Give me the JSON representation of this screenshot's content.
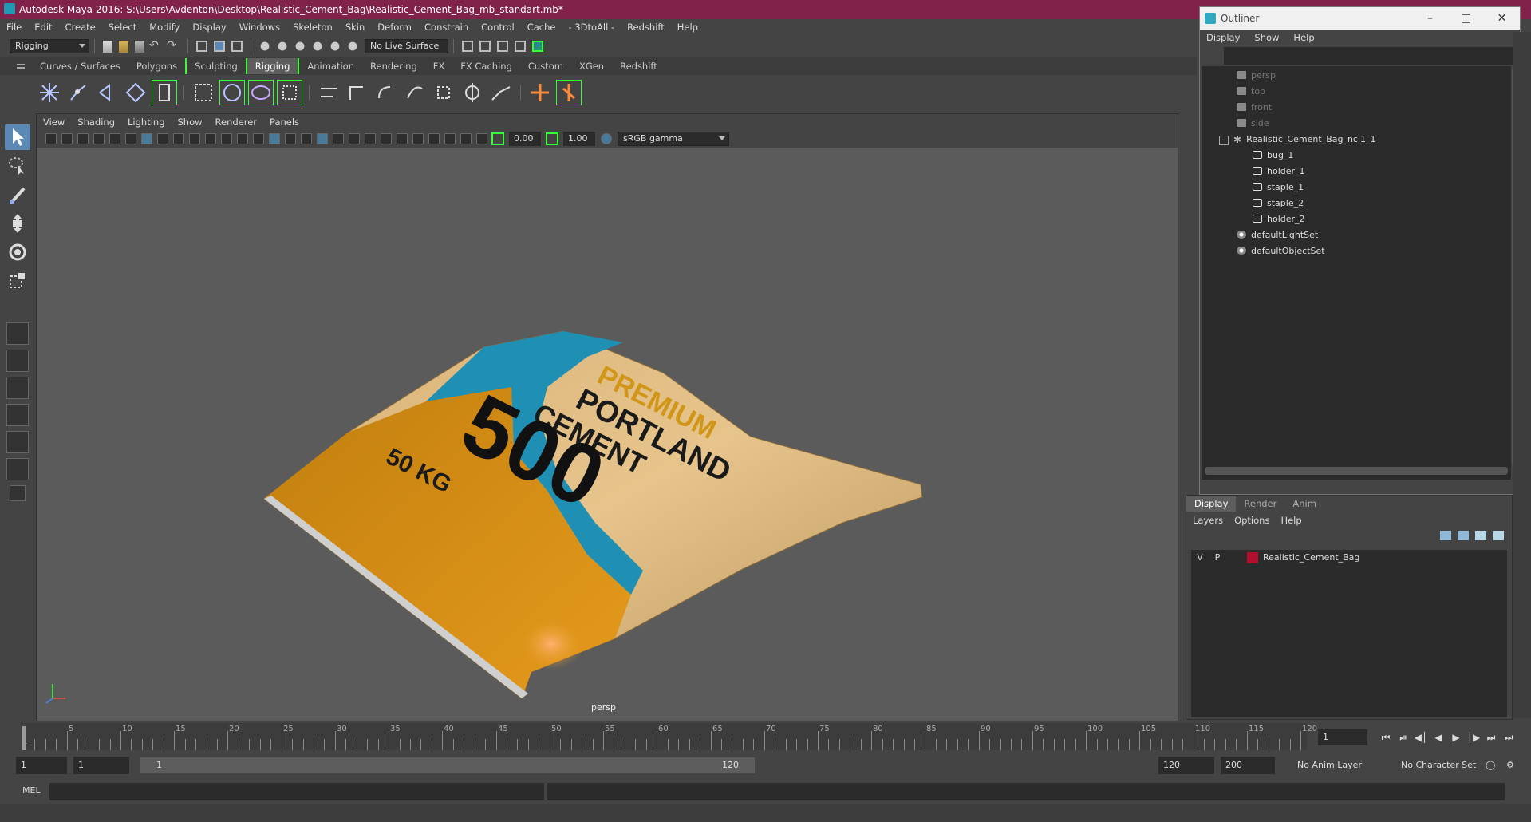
{
  "window": {
    "title": "Autodesk Maya 2016: S:\\Users\\Avdenton\\Desktop\\Realistic_Cement_Bag\\Realistic_Cement_Bag_mb_standart.mb*"
  },
  "menubar": [
    "File",
    "Edit",
    "Create",
    "Select",
    "Modify",
    "Display",
    "Windows",
    "Skeleton",
    "Skin",
    "Deform",
    "Constrain",
    "Control",
    "Cache",
    "- 3DtoAll -",
    "Redshift",
    "Help"
  ],
  "statusline": {
    "menuset": "Rigging",
    "live_surface": "No Live Surface"
  },
  "shelf_tabs": [
    "Curves / Surfaces",
    "Polygons",
    "Sculpting",
    "Rigging",
    "Animation",
    "Rendering",
    "FX",
    "FX Caching",
    "Custom",
    "XGen",
    "Redshift"
  ],
  "shelf_active_tab": "Rigging",
  "viewport": {
    "menu": [
      "View",
      "Shading",
      "Lighting",
      "Show",
      "Renderer",
      "Panels"
    ],
    "exposure": "0.00",
    "gamma": "1.00",
    "color_space": "sRGB gamma",
    "camera_label": "persp",
    "bag_text": {
      "line1": "PREMIUM",
      "line2": "PORTLAND",
      "line3": "CEMENT",
      "grade": "500",
      "weight": "50 KG"
    }
  },
  "outliner": {
    "title": "Outliner",
    "menu": [
      "Display",
      "Show",
      "Help"
    ],
    "items": [
      {
        "label": "persp",
        "type": "camera",
        "dim": true
      },
      {
        "label": "top",
        "type": "camera",
        "dim": true
      },
      {
        "label": "front",
        "type": "camera",
        "dim": true
      },
      {
        "label": "side",
        "type": "camera",
        "dim": true
      },
      {
        "label": "Realistic_Cement_Bag_ncl1_1",
        "type": "group"
      },
      {
        "label": "bug_1",
        "type": "mesh"
      },
      {
        "label": "holder_1",
        "type": "mesh"
      },
      {
        "label": "staple_1",
        "type": "mesh"
      },
      {
        "label": "staple_2",
        "type": "mesh"
      },
      {
        "label": "holder_2",
        "type": "mesh"
      },
      {
        "label": "defaultLightSet",
        "type": "set"
      },
      {
        "label": "defaultObjectSet",
        "type": "set"
      }
    ]
  },
  "layer_editor": {
    "tabs": [
      "Display",
      "Render",
      "Anim"
    ],
    "menu": [
      "Layers",
      "Options",
      "Help"
    ],
    "layer": {
      "v": "V",
      "p": "P",
      "name": "Realistic_Cement_Bag",
      "color": "#b0102e"
    }
  },
  "timeline": {
    "labels": [
      "1",
      "5",
      "10",
      "15",
      "20",
      "25",
      "30",
      "35",
      "40",
      "45",
      "50",
      "55",
      "60",
      "65",
      "70",
      "75",
      "80",
      "85",
      "90",
      "95",
      "100",
      "105",
      "110",
      "115",
      "120"
    ],
    "current_frame": "1"
  },
  "range": {
    "start": "1",
    "playback_start": "1",
    "bar_start": "1",
    "bar_end": "120",
    "playback_end": "120",
    "end": "200",
    "anim_layer": "No Anim Layer",
    "character_set": "No Character Set"
  },
  "cmdline": {
    "label": "MEL"
  },
  "colors": {
    "titlebar": "#802249",
    "highlight": "#37ff37",
    "selection": "#5c88b5"
  }
}
